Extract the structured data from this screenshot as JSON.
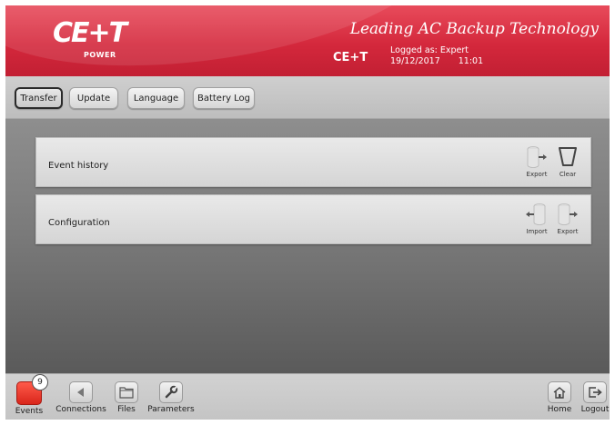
{
  "header": {
    "logo_text": "CE+T",
    "logo_sub": "POWER",
    "tagline": "Leading AC Backup Technology",
    "company": "CE+T",
    "logged_as": "Logged as: Expert",
    "date": "19/12/2017",
    "time": "11:01",
    "brand_color": "#d4283c"
  },
  "toolbar": {
    "buttons": [
      {
        "label": "Transfer",
        "active": true
      },
      {
        "label": "Update",
        "active": false
      },
      {
        "label": "Language",
        "active": false
      },
      {
        "label": "Battery Log",
        "active": false
      }
    ]
  },
  "panels": [
    {
      "label": "Event history",
      "actions": [
        {
          "label": "Export",
          "icon": "export-icon"
        },
        {
          "label": "Clear",
          "icon": "clear-icon"
        }
      ]
    },
    {
      "label": "Configuration",
      "actions": [
        {
          "label": "Import",
          "icon": "import-icon"
        },
        {
          "label": "Export",
          "icon": "export-icon"
        }
      ]
    }
  ],
  "bottom": {
    "events_label": "Events",
    "events_count": "9",
    "connections_label": "Connections",
    "files_label": "Files",
    "parameters_label": "Parameters",
    "home_label": "Home",
    "logout_label": "Logout"
  }
}
